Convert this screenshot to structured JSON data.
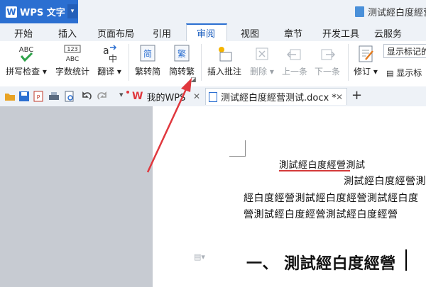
{
  "app": {
    "menu_label": "WPS 文字",
    "logo_letter": "W",
    "document_title": "测试經白度經营"
  },
  "tabs": [
    "开始",
    "插入",
    "页面布局",
    "引用",
    "审阅",
    "视图",
    "章节",
    "开发工具",
    "云服务"
  ],
  "active_tab": "审阅",
  "ribbon": {
    "spell_check": {
      "label": "拼写检查",
      "icon_text": "ABC"
    },
    "word_count": {
      "label": "字数统计",
      "icon_text_top": "123",
      "icon_text_bottom": "ABC"
    },
    "translate": {
      "label": "翻译",
      "icon_text": "a"
    },
    "trad_to_simp": {
      "label": "繁转简",
      "icon_char": "简"
    },
    "simp_to_trad": {
      "label": "简转繁",
      "icon_char": "繁"
    },
    "insert_comment": {
      "label": "插入批注"
    },
    "delete": {
      "label": "删除"
    },
    "prev": {
      "label": "上一条"
    },
    "next": {
      "label": "下一条"
    },
    "revise": {
      "label": "修订"
    },
    "markup_select": {
      "value": "显示标记的最"
    },
    "show_markup": {
      "label": "显示标"
    }
  },
  "doc_tabs": [
    {
      "label": "我的WPS"
    },
    {
      "label": "测试經白度經营测试.docx *"
    }
  ],
  "document": {
    "heading_underlined": "測試經白度經營測試",
    "line1": "測試經白度經營測",
    "line2": "經白度經營測試經白度經營測試經白度",
    "line3": "營測試經白度經營測試經白度經營",
    "heading1": "一、 測試經白度經營"
  },
  "colors": {
    "accent": "#2b6fd1",
    "arrow": "#e0383e",
    "underline": "#d43a3a"
  }
}
